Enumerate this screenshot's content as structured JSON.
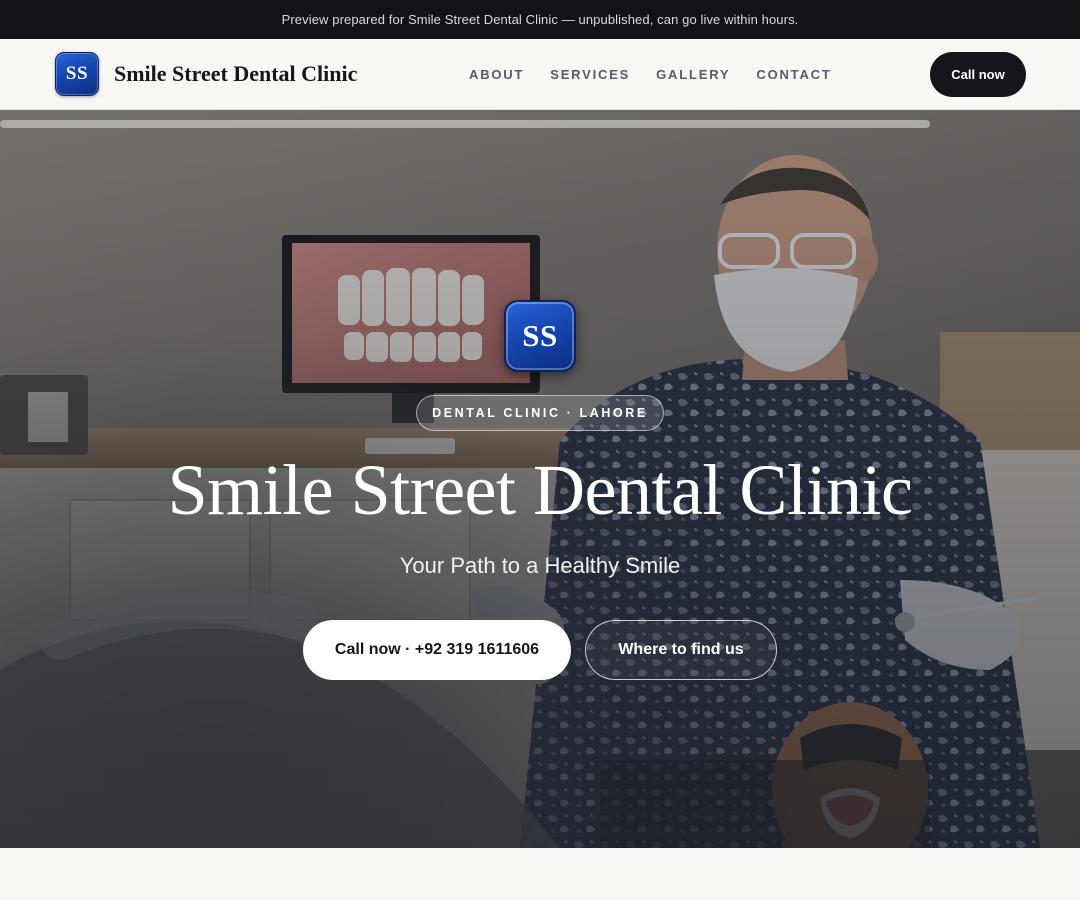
{
  "preview_banner": {
    "text": "Preview prepared for Smile Street Dental Clinic — unpublished, can go live within hours."
  },
  "header": {
    "logo_initials": "SS",
    "brand_name": "Smile Street Dental Clinic",
    "nav": [
      {
        "label": "ABOUT"
      },
      {
        "label": "SERVICES"
      },
      {
        "label": "GALLERY"
      },
      {
        "label": "CONTACT"
      }
    ],
    "cta_label": "Call now"
  },
  "hero": {
    "badge_initials": "SS",
    "eyebrow": "DENTAL CLINIC · LAHORE",
    "title": "Smile Street Dental Clinic",
    "subtitle": "Your Path to a Healthy Smile",
    "primary_button": "Call now · +92 319 1611606",
    "secondary_button": "Where to find us",
    "background_image": "dentist-examining-patient-photo"
  },
  "colors": {
    "brand_blue": "#1546b0",
    "dark": "#14161b",
    "page_bg": "#f8f7f4"
  }
}
